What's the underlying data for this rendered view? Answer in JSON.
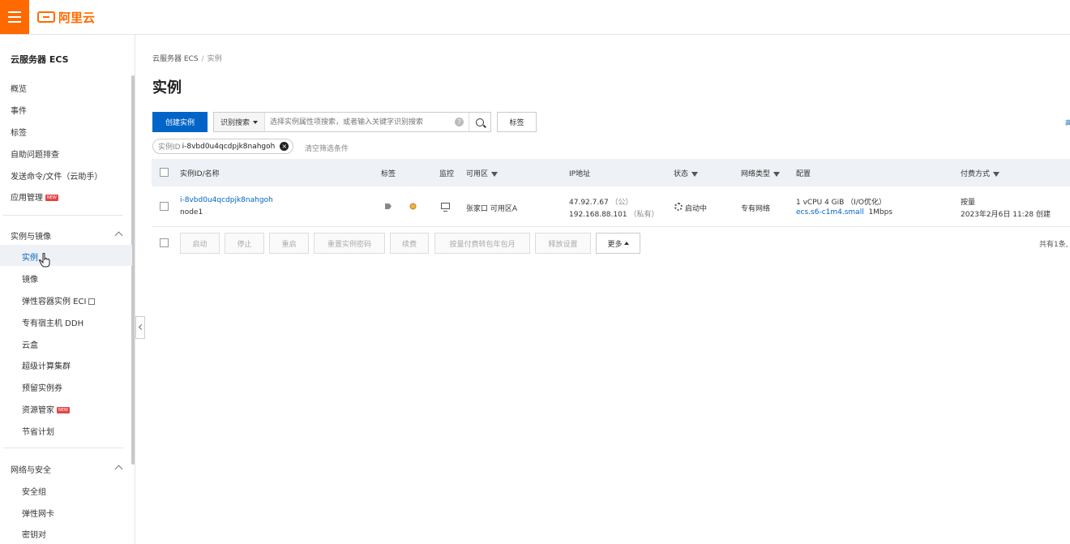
{
  "header": {
    "logo_text": "阿里云",
    "accent_color": "#ff6a00",
    "menu_icon": "hamburger-icon",
    "logo_icon": "aliyun-bracket-icon"
  },
  "sidebar": {
    "title": "云服务器 ECS",
    "top_items": [
      "概览",
      "事件",
      "标签",
      "自助问题排查",
      "发送命令/文件（云助手）",
      "应用管理"
    ],
    "new_badge": "NEW",
    "group1": {
      "label": "实例与镜像",
      "items": [
        "实例",
        "镜像",
        "弹性容器实例 ECI",
        "专有宿主机 DDH",
        "云盒",
        "超级计算集群",
        "预留实例券",
        "资源管家",
        "节省计划"
      ],
      "active": "实例"
    },
    "group2": {
      "label": "网络与安全",
      "items": [
        "安全组",
        "弹性网卡",
        "密钥对"
      ]
    }
  },
  "breadcrumb": {
    "root": "云服务器 ECS",
    "separator": "/",
    "current": "实例"
  },
  "page_title": "实例",
  "toolbar": {
    "create_label": "创建实例",
    "search_type": "识别搜索",
    "search_placeholder": "选择实例属性项搜索，或者输入关键字识别搜索",
    "help": "?",
    "tag_label": "标签",
    "edge_text": "高"
  },
  "filter": {
    "key": "实例ID",
    "value": "i-8vbd0u4qcdpjk8nahgoh",
    "clear": "清空筛选条件",
    "remove": "×"
  },
  "table": {
    "columns": [
      "实例ID/名称",
      "标签",
      "监控",
      "可用区",
      "IP地址",
      "状态",
      "网络类型",
      "配置",
      "付费方式"
    ],
    "rows": [
      {
        "id": "i-8vbd0u4qcdpjk8nahgoh",
        "name": "node1",
        "zone": "张家口 可用区A",
        "ip_public": "47.92.7.67",
        "ip_public_tag": "（公）",
        "ip_private": "192.168.88.101",
        "ip_private_tag": "（私有）",
        "status": "启动中",
        "network": "专有网络",
        "config": "1 vCPU 4 GiB （I/O优化）",
        "instance_type": "ecs.s6-c1m4.small",
        "bandwidth": "1Mbps",
        "billing": "按量",
        "created": "2023年2月6日 11:28 创建"
      }
    ]
  },
  "actions": {
    "buttons": [
      "启动",
      "停止",
      "重启",
      "重置实例密码",
      "续费",
      "按量付费转包年包月",
      "释放设置"
    ],
    "more": "更多",
    "total": "共有1条,"
  }
}
